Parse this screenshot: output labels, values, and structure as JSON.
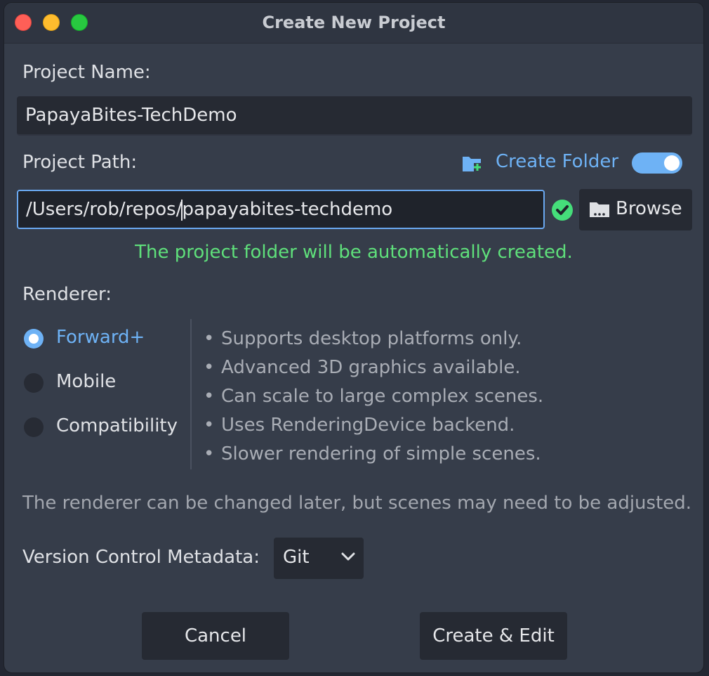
{
  "window": {
    "title": "Create New Project"
  },
  "project_name": {
    "label": "Project Name:",
    "value": "PapayaBites-TechDemo"
  },
  "project_path": {
    "label": "Project Path:",
    "value_before_caret": "/Users/rob/repos/",
    "value_after_caret": "papayabites-techdemo",
    "create_folder_label": "Create Folder",
    "create_folder_enabled": true,
    "browse_label": "Browse",
    "status_message": "The project folder will be automatically created.",
    "status_color": "#5fe07b"
  },
  "renderer": {
    "label": "Renderer:",
    "options": [
      {
        "label": "Forward+",
        "selected": true
      },
      {
        "label": "Mobile",
        "selected": false
      },
      {
        "label": "Compatibility",
        "selected": false
      }
    ],
    "bullet": "•",
    "details": [
      "Supports desktop platforms only.",
      "Advanced 3D graphics available.",
      "Can scale to large complex scenes.",
      "Uses RenderingDevice backend.",
      "Slower rendering of simple scenes."
    ],
    "note": "The renderer can be changed later, but scenes may need to be adjusted."
  },
  "version_control": {
    "label": "Version Control Metadata:",
    "selected": "Git"
  },
  "buttons": {
    "cancel": "Cancel",
    "create_edit": "Create & Edit"
  },
  "colors": {
    "accent": "#6eb2f5",
    "success": "#45de7a",
    "close": "#ff5f57",
    "minimize": "#febc2e",
    "maximize": "#28c840"
  },
  "icons": {
    "create_folder": "folder-add-icon",
    "valid": "check-circle-icon",
    "browse": "folder-icon",
    "select": "chevron-down-icon"
  }
}
